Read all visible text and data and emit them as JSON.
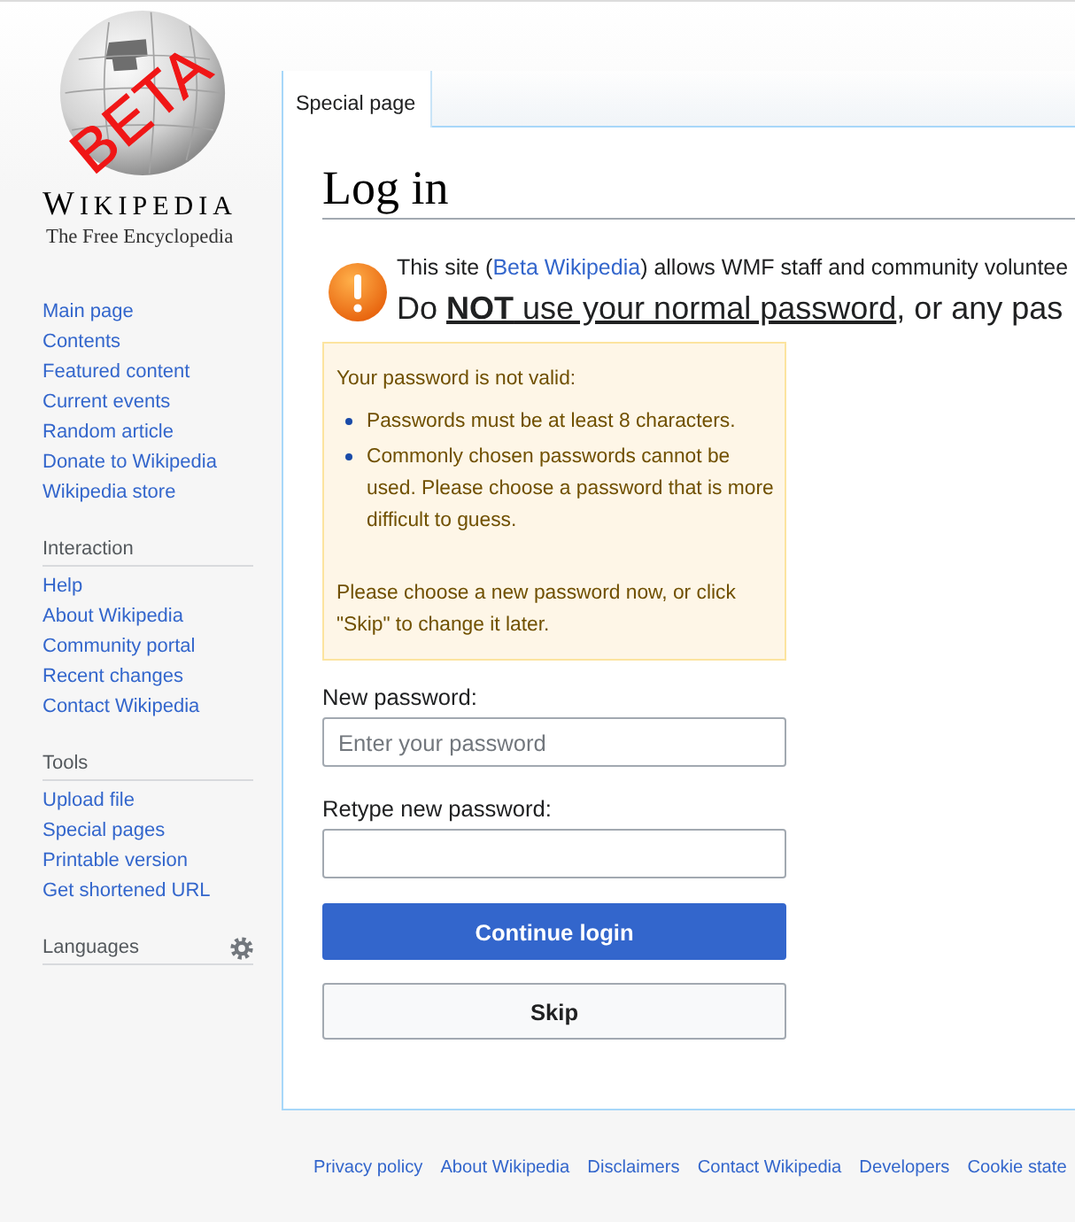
{
  "logo": {
    "badge": "BETA",
    "wordmark": "WIKIPEDIA",
    "tagline": "The Free Encyclopedia"
  },
  "sidebar": {
    "navigation": [
      "Main page",
      "Contents",
      "Featured content",
      "Current events",
      "Random article",
      "Donate to Wikipedia",
      "Wikipedia store"
    ],
    "sections": [
      {
        "heading": "Interaction",
        "items": [
          "Help",
          "About Wikipedia",
          "Community portal",
          "Recent changes",
          "Contact Wikipedia"
        ]
      },
      {
        "heading": "Tools",
        "items": [
          "Upload file",
          "Special pages",
          "Printable version",
          "Get shortened URL"
        ]
      }
    ],
    "languages": {
      "heading": "Languages"
    }
  },
  "tabs": [
    {
      "label": "Special page",
      "selected": true
    }
  ],
  "page": {
    "title": "Log in",
    "notice": {
      "line_1": {
        "before": "This site (",
        "link": "Beta Wikipedia",
        "after": ") allows WMF staff and community voluntee"
      },
      "line_2": {
        "before": "Do ",
        "underlined": "**NOT** use your normal password",
        "after": ", or any pas"
      }
    },
    "error": {
      "heading": "Your password is not valid:",
      "items": [
        "Passwords must be at least 8 characters.",
        "Commonly chosen passwords cannot be used. Please choose a password that is more difficult to guess."
      ],
      "note": "Please choose a new password now, or click \"Skip\" to change it later."
    },
    "form": {
      "fields": [
        {
          "label": "New password:",
          "placeholder": "Enter your password"
        },
        {
          "label": "Retype new password:"
        }
      ],
      "buttons": [
        {
          "label": "Continue login",
          "kind": "primary"
        },
        {
          "label": "Skip",
          "kind": "secondary"
        }
      ]
    }
  },
  "footer": {
    "links": [
      "Privacy policy",
      "About Wikipedia",
      "Disclaimers",
      "Contact Wikipedia",
      "Developers",
      "Cookie state"
    ]
  }
}
